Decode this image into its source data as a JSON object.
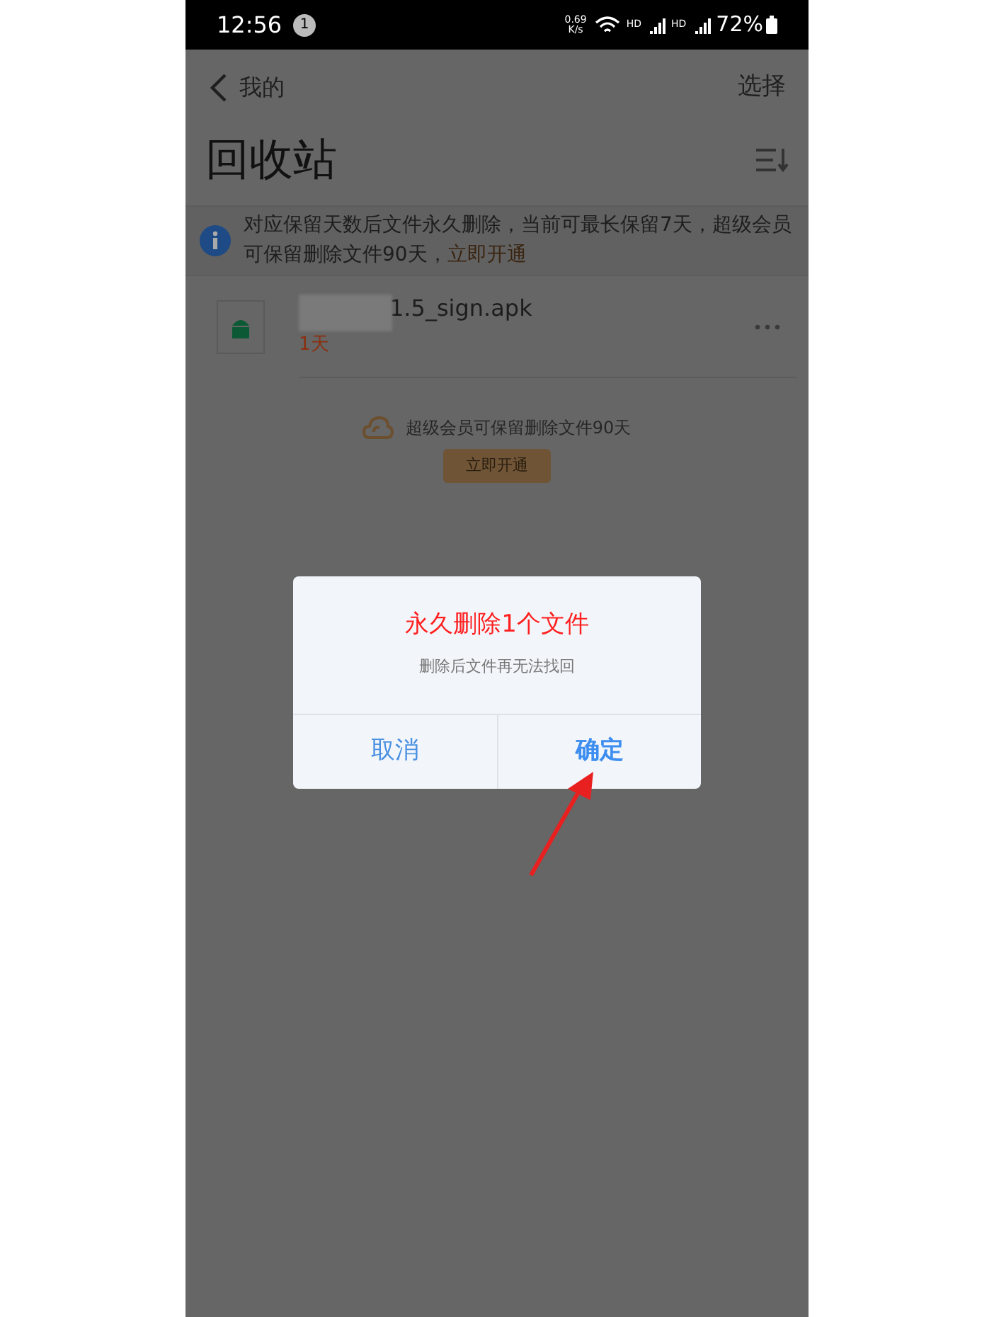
{
  "status_bar": {
    "time": "12:56",
    "notification_count": "1",
    "net_speed_value": "0.69",
    "net_speed_unit": "K/s",
    "signal_1": "HD",
    "signal_2": "HD",
    "battery": "72%"
  },
  "nav": {
    "back_label": "我的",
    "action": "选择"
  },
  "title": "回收站",
  "notice": {
    "text": "对应保留天数后文件永久删除，当前可最长保留7天，超级会员可保留删除文件90天，",
    "link": "立即开通"
  },
  "files": [
    {
      "name": "1.5_sign.apk",
      "days_left": "1天"
    }
  ],
  "promo": {
    "text": "超级会员可保留删除文件90天",
    "button": "立即开通"
  },
  "dialog": {
    "title": "永久删除1个文件",
    "message": "删除后文件再无法找回",
    "buttons": [
      {
        "label": "取消",
        "selected": false
      },
      {
        "label": "确定",
        "selected": true
      }
    ]
  }
}
